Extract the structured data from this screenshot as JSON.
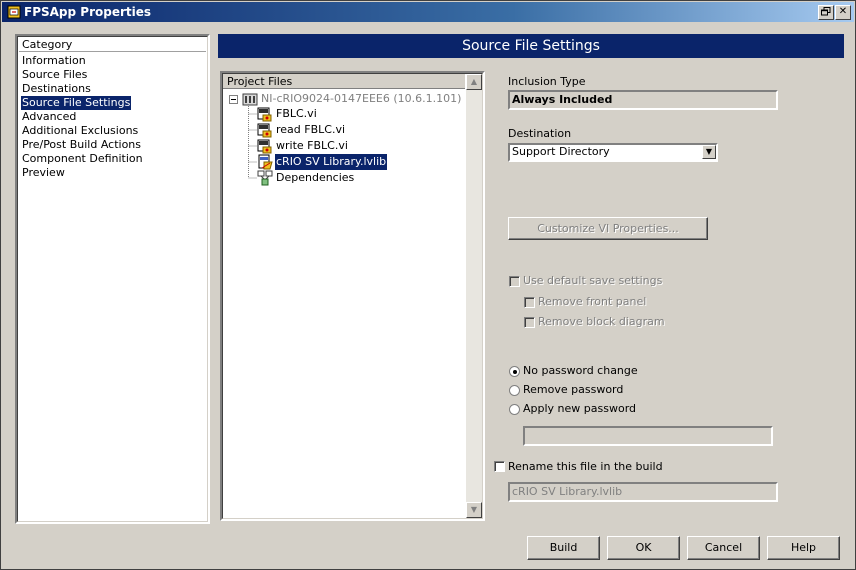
{
  "window": {
    "title": "FPSApp Properties"
  },
  "category": {
    "header": "Category",
    "items": [
      {
        "label": "Information"
      },
      {
        "label": "Source Files"
      },
      {
        "label": "Destinations"
      },
      {
        "label": "Source File Settings",
        "selected": true
      },
      {
        "label": "Advanced"
      },
      {
        "label": "Additional Exclusions"
      },
      {
        "label": "Pre/Post Build Actions"
      },
      {
        "label": "Component Definition"
      },
      {
        "label": "Preview"
      }
    ]
  },
  "banner": {
    "title": "Source File Settings"
  },
  "project_files": {
    "header": "Project Files",
    "root": "NI-cRIO9024-0147EEE6 (10.6.1.101)",
    "children": [
      {
        "label": "FBLC.vi",
        "icon": "vi-icon"
      },
      {
        "label": "read FBLC.vi",
        "icon": "vi-icon"
      },
      {
        "label": "write FBLC.vi",
        "icon": "vi-icon"
      },
      {
        "label": "cRIO SV Library.lvlib",
        "icon": "library-icon",
        "selected": true
      },
      {
        "label": "Dependencies",
        "icon": "dependencies-icon"
      }
    ]
  },
  "settings": {
    "inclusion_type_label": "Inclusion Type",
    "inclusion_type_value": "Always Included",
    "destination_label": "Destination",
    "destination_value": "Support Directory",
    "customize_button": "Customize VI Properties...",
    "use_default_save": "Use default save settings",
    "remove_front_panel": "Remove front panel",
    "remove_block_diagram": "Remove block diagram",
    "password_options": [
      {
        "label": "No password change",
        "selected": true
      },
      {
        "label": "Remove password",
        "selected": false
      },
      {
        "label": "Apply new password",
        "selected": false
      }
    ],
    "password_value": "",
    "rename_label": "Rename this file in the build",
    "rename_value": "cRIO SV Library.lvlib"
  },
  "buttons": {
    "build": "Build",
    "ok": "OK",
    "cancel": "Cancel",
    "help": "Help"
  },
  "colors": {
    "selection": "#0a246a",
    "face": "#d4d0c8"
  }
}
